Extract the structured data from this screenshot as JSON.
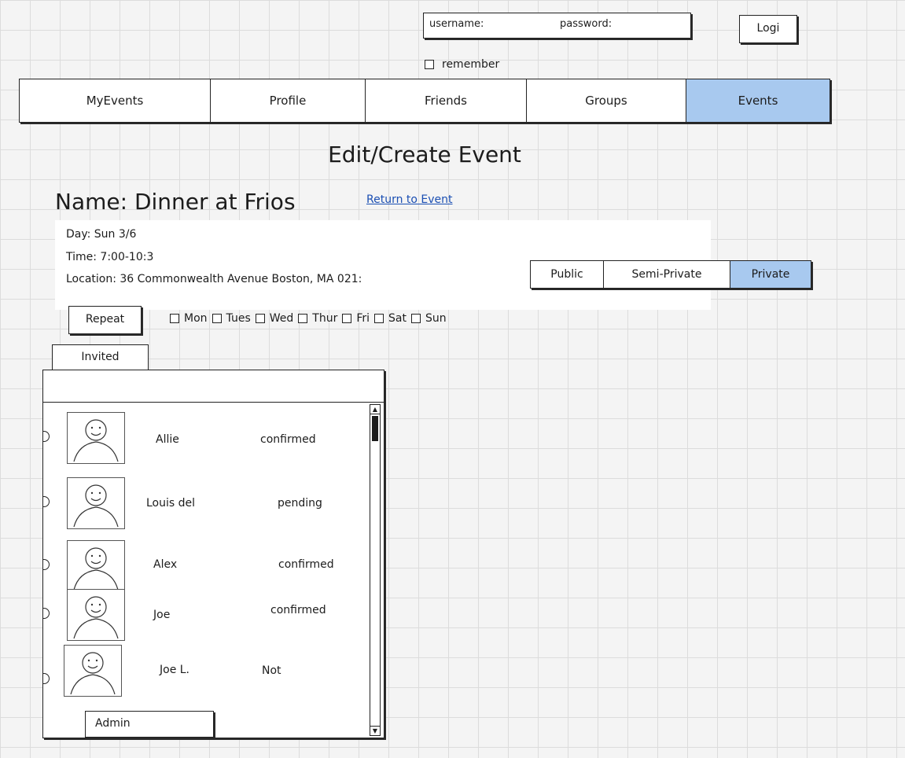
{
  "login": {
    "username_label": "username:",
    "password_label": "password:",
    "login_button": "Logi",
    "remember_label": "remember"
  },
  "nav": {
    "tabs": [
      {
        "label": "MyEvents",
        "active": false
      },
      {
        "label": "Profile",
        "active": false
      },
      {
        "label": "Friends",
        "active": false
      },
      {
        "label": "Groups",
        "active": false
      },
      {
        "label": "Events",
        "active": true
      }
    ]
  },
  "page": {
    "title": "Edit/Create Event",
    "event_name": "Name: Dinner at Frios",
    "return_link": "Return to Event"
  },
  "details": {
    "day": "Day: Sun 3/6",
    "time": "Time: 7:00-10:3",
    "location": "Location: 36 Commonwealth Avenue Boston, MA 021:"
  },
  "privacy": {
    "options": [
      "Public",
      "Semi-Private",
      "Private"
    ],
    "selected": "Private"
  },
  "repeat": {
    "button": "Repeat",
    "days": [
      "Mon",
      "Tues",
      "Wed",
      "Thur",
      "Fri",
      "Sat",
      "Sun"
    ]
  },
  "invited": {
    "tab_label": "Invited",
    "people": [
      {
        "name": "Allie",
        "status": "confirmed"
      },
      {
        "name": "Louis del",
        "status": "pending"
      },
      {
        "name": "Alex",
        "status": "confirmed"
      },
      {
        "name": "Joe",
        "status": "confirmed"
      },
      {
        "name": "Joe L.",
        "status": "Not"
      }
    ],
    "admin_button": "Admin"
  },
  "colors": {
    "active_tab": "#a8c9ef",
    "link": "#1b4fb3"
  }
}
